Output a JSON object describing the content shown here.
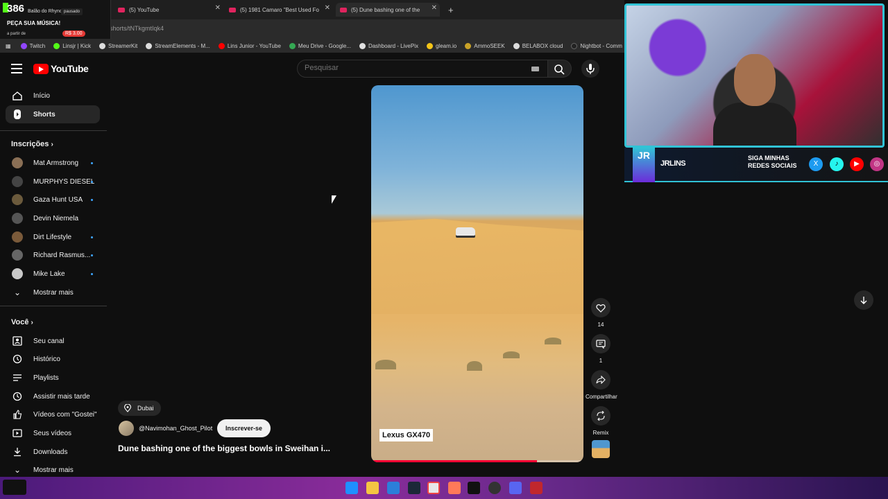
{
  "browser": {
    "tabs": [
      {
        "label": "(5) YouTube"
      },
      {
        "label": "(5) 1981 Camaro \"Best Used Fo"
      },
      {
        "label": "(5) Dune bashing one of the"
      }
    ],
    "url": "youtube.com/shorts/tNTkgmtIqk4",
    "bookmarks": [
      {
        "label": "Twitch",
        "color": "#9146ff"
      },
      {
        "label": "Linsjr | Kick",
        "color": "#53fc18"
      },
      {
        "label": "StreamerKit",
        "color": "#dddddd"
      },
      {
        "label": "StreamElements - M...",
        "color": "#dddddd"
      },
      {
        "label": "Lins Junior - YouTube",
        "color": "#ff0000"
      },
      {
        "label": "Meu Drive - Google...",
        "color": "#34a853"
      },
      {
        "label": "Dashboard - LivePix",
        "color": "#e0e0e0"
      },
      {
        "label": "gleam.io",
        "color": "#f5c518"
      },
      {
        "label": "AmmoSEEK",
        "color": "#c9a227"
      },
      {
        "label": "BELABOX cloud",
        "color": "#dddddd"
      },
      {
        "label": "Nightbot - Comm",
        "color": "#222222"
      }
    ]
  },
  "widget": {
    "count": "386",
    "artist": "Balão do Rhyno",
    "status": "pausado",
    "title": "PEÇA SUA MÚSICA!",
    "from": "a partir de",
    "price": "R$ 3.00"
  },
  "header": {
    "logo_text": "YouTube",
    "search_placeholder": "Pesquisar"
  },
  "sidebar": {
    "main": [
      {
        "label": "Início",
        "icon": "home-icon"
      },
      {
        "label": "Shorts",
        "icon": "shorts-icon"
      }
    ],
    "subscriptions_title": "Inscrições",
    "subscriptions": [
      {
        "label": "Mat Armstrong",
        "color": "#8a6f55"
      },
      {
        "label": "MURPHYS DIESEL",
        "color": "#444444"
      },
      {
        "label": "Gaza Hunt USA",
        "color": "#6b5a3c"
      },
      {
        "label": "Devin Niemela",
        "color": "#555555"
      },
      {
        "label": "Dirt Lifestyle",
        "color": "#7a5a3a"
      },
      {
        "label": "Richard Rasmus...",
        "color": "#666666"
      },
      {
        "label": "Mike Lake",
        "color": "#c8c8c8"
      }
    ],
    "show_more": "Mostrar mais",
    "you_title": "Você",
    "you": [
      {
        "label": "Seu canal",
        "icon": "channel-icon"
      },
      {
        "label": "Histórico",
        "icon": "history-icon"
      },
      {
        "label": "Playlists",
        "icon": "playlists-icon"
      },
      {
        "label": "Assistir mais tarde",
        "icon": "watch-later-icon"
      },
      {
        "label": "Vídeos com \"Gostei\"",
        "icon": "liked-icon"
      },
      {
        "label": "Seus vídeos",
        "icon": "your-videos-icon"
      },
      {
        "label": "Downloads",
        "icon": "downloads-icon"
      }
    ],
    "show_more_2": "Mostrar mais"
  },
  "short": {
    "caption": "Lexus GX470",
    "progress": 0.78,
    "location": "Dubai",
    "channel": "@Navimohan_Ghost_Pilot",
    "subscribe": "Inscrever-se",
    "title": "Dune bashing one of the biggest bowls in Sweihan i..."
  },
  "actions": {
    "likes": "14",
    "comments": "1",
    "share": "Compartilhar",
    "remix": "Remix"
  },
  "overlay": {
    "badge": "JR",
    "name": "JRLINS",
    "follow": "SIGA MINHAS REDES SOCIAIS"
  }
}
